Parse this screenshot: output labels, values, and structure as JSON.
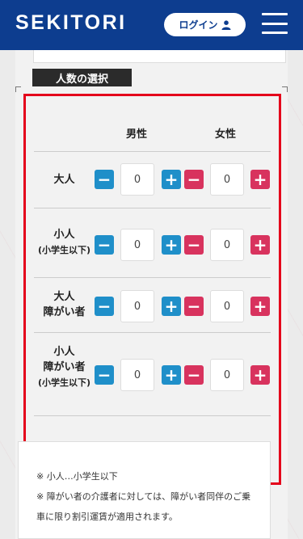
{
  "header": {
    "logo": "SEKITORI",
    "login_label": "ログイン"
  },
  "section": {
    "title": "人数の選択",
    "col_male": "男性",
    "col_female": "女性"
  },
  "rows": [
    {
      "label": "大人",
      "sub": "",
      "male": "0",
      "female": "0"
    },
    {
      "label": "小人",
      "sub": "(小学生以下)",
      "male": "0",
      "female": "0"
    },
    {
      "label": "大人",
      "label2": "障がい者",
      "sub": "",
      "male": "0",
      "female": "0"
    },
    {
      "label": "小人",
      "label2": "障がい者",
      "sub": "(小学生以下)",
      "male": "0",
      "female": "0"
    }
  ],
  "notes": {
    "line1": "※ 小人…小学生以下",
    "line2": "※ 障がい者の介護者に対しては、障がい者同伴のご乗",
    "line3": "車に限り割引運賃が適用されます。"
  },
  "colors": {
    "header_bg": "#0d3d8f",
    "minus_btn": "#1f8fc9",
    "plus_btn": "#d8335e",
    "highlight_border": "#e4001b"
  }
}
